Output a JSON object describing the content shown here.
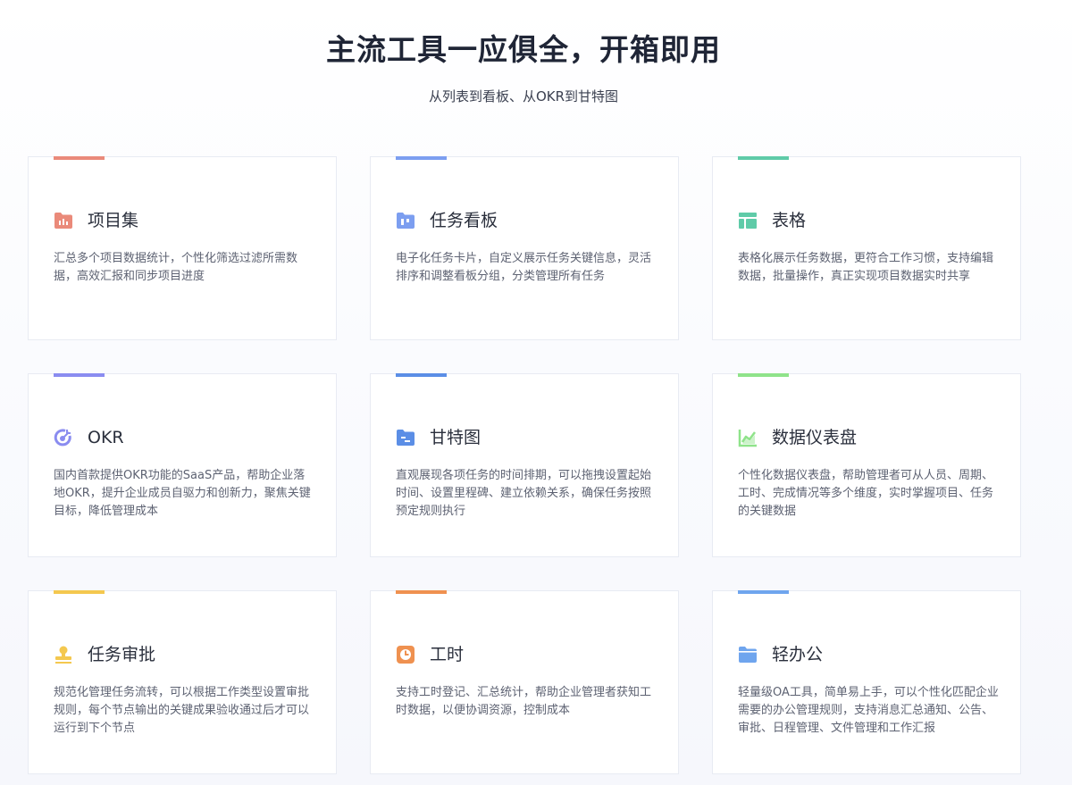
{
  "header": {
    "title": "主流工具一应俱全，开箱即用",
    "subtitle": "从列表到看板、从OKR到甘特图"
  },
  "cards": [
    {
      "title": "项目集",
      "desc": "汇总多个项目数据统计，个性化筛选过滤所需数据，高效汇报和同步项目进度",
      "accent": "#ea8a7a",
      "icon": "project-folder-icon"
    },
    {
      "title": "任务看板",
      "desc": "电子化任务卡片，自定义展示任务关键信息，灵活排序和调整看板分组，分类管理所有任务",
      "accent": "#7c9ef0",
      "icon": "kanban-board-icon"
    },
    {
      "title": "表格",
      "desc": "表格化展示任务数据，更符合工作习惯，支持编辑数据，批量操作，真正实现项目数据实时共享",
      "accent": "#5fcba8",
      "icon": "table-icon"
    },
    {
      "title": "OKR",
      "desc": "国内首款提供OKR功能的SaaS产品，帮助企业落地OKR，提升企业成员自驱力和创新力，聚焦关键目标，降低管理成本",
      "accent": "#8a8cf0",
      "icon": "target-icon"
    },
    {
      "title": "甘特图",
      "desc": "直观展现各项任务的时间排期，可以拖拽设置起始时间、设置里程碑、建立依赖关系，确保任务按照预定规则执行",
      "accent": "#5b8ee6",
      "icon": "gantt-folder-icon"
    },
    {
      "title": "数据仪表盘",
      "desc": "个性化数据仪表盘，帮助管理者可从人员、周期、工时、完成情况等多个维度，实时掌握项目、任务的关键数据",
      "accent": "#8fe38a",
      "icon": "line-chart-icon"
    },
    {
      "title": "任务审批",
      "desc": "规范化管理任务流转，可以根据工作类型设置审批规则，每个节点输出的关键成果验收通过后才可以运行到下个节点",
      "accent": "#f4c84f",
      "icon": "approval-stamp-icon"
    },
    {
      "title": "工时",
      "desc": "支持工时登记、汇总统计，帮助企业管理者获知工时数据，以便协调资源，控制成本",
      "accent": "#ef9150",
      "icon": "clock-icon"
    },
    {
      "title": "轻办公",
      "desc": "轻量级OA工具，简单易上手，可以个性化匹配企业需要的办公管理规则，支持消息汇总通知、公告、审批、日程管理、文件管理和工作汇报",
      "accent": "#6fa5ee",
      "icon": "office-folder-icon"
    }
  ]
}
